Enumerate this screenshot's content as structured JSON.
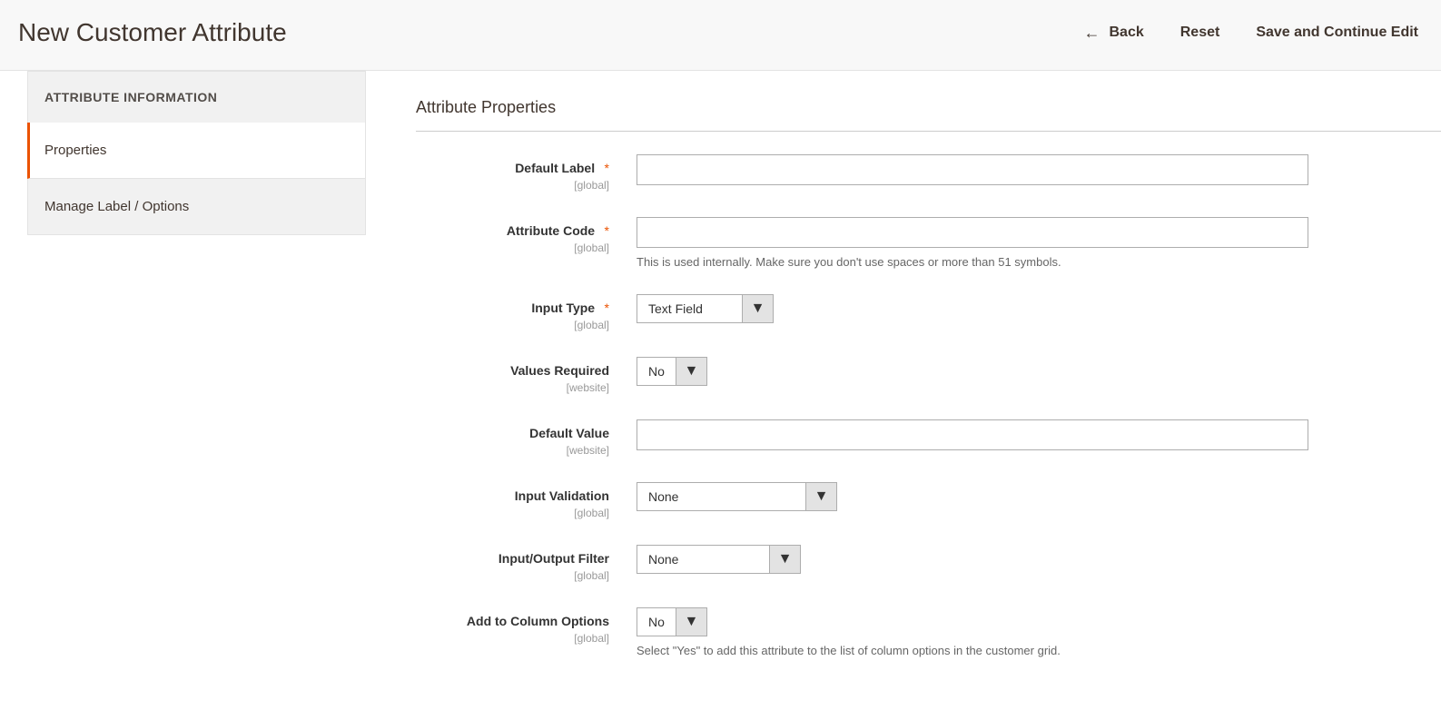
{
  "header": {
    "title": "New Customer Attribute",
    "back": "Back",
    "reset": "Reset",
    "save_continue": "Save and Continue Edit"
  },
  "sidebar": {
    "title": "ATTRIBUTE INFORMATION",
    "items": [
      {
        "label": "Properties",
        "active": true
      },
      {
        "label": "Manage Label / Options",
        "active": false
      }
    ]
  },
  "main": {
    "section_title": "Attribute Properties",
    "fields": {
      "default_label": {
        "label": "Default Label",
        "scope": "[global]",
        "required": true,
        "value": ""
      },
      "attribute_code": {
        "label": "Attribute Code",
        "scope": "[global]",
        "required": true,
        "value": "",
        "help": "This is used internally. Make sure you don't use spaces or more than 51 symbols."
      },
      "input_type": {
        "label": "Input Type",
        "scope": "[global]",
        "required": true,
        "value": "Text Field"
      },
      "values_required": {
        "label": "Values Required",
        "scope": "[website]",
        "value": "No"
      },
      "default_value": {
        "label": "Default Value",
        "scope": "[website]",
        "value": ""
      },
      "input_validation": {
        "label": "Input Validation",
        "scope": "[global]",
        "value": "None"
      },
      "io_filter": {
        "label": "Input/Output Filter",
        "scope": "[global]",
        "value": "None"
      },
      "add_column": {
        "label": "Add to Column Options",
        "scope": "[global]",
        "value": "No",
        "help": "Select \"Yes\" to add this attribute to the list of column options in the customer grid."
      }
    },
    "required_mark": "*"
  }
}
